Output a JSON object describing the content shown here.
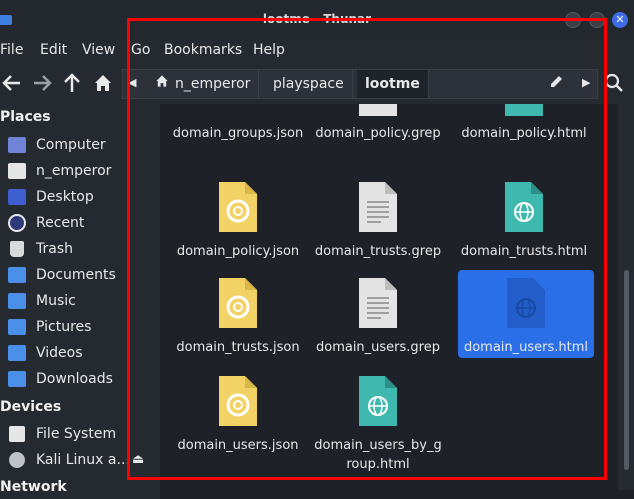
{
  "window": {
    "title": "lootme - Thunar"
  },
  "menu": [
    "File",
    "Edit",
    "View",
    "Go",
    "Bookmarks",
    "Help"
  ],
  "pathbar": {
    "crumbs": [
      "n_emperor",
      "playspace",
      "lootme"
    ]
  },
  "sidebar": {
    "places_header": "Places",
    "places": [
      {
        "label": "Computer",
        "icon": "computer-icon"
      },
      {
        "label": "n_emperor",
        "icon": "home-folder-icon"
      },
      {
        "label": "Desktop",
        "icon": "desktop-icon"
      },
      {
        "label": "Recent",
        "icon": "recent-icon"
      },
      {
        "label": "Trash",
        "icon": "trash-icon"
      },
      {
        "label": "Documents",
        "icon": "documents-folder-icon"
      },
      {
        "label": "Music",
        "icon": "music-folder-icon"
      },
      {
        "label": "Pictures",
        "icon": "pictures-folder-icon"
      },
      {
        "label": "Videos",
        "icon": "videos-folder-icon"
      },
      {
        "label": "Downloads",
        "icon": "downloads-folder-icon"
      }
    ],
    "devices_header": "Devices",
    "devices": [
      {
        "label": "File System",
        "icon": "drive-icon"
      },
      {
        "label": "Kali Linux a...",
        "icon": "disc-icon"
      }
    ],
    "network_header": "Network"
  },
  "files": [
    {
      "name": "domain_groups.json",
      "type": "json"
    },
    {
      "name": "domain_policy.grep",
      "type": "text"
    },
    {
      "name": "domain_policy.html",
      "type": "html"
    },
    {
      "name": "domain_policy.json",
      "type": "json"
    },
    {
      "name": "domain_trusts.grep",
      "type": "text"
    },
    {
      "name": "domain_trusts.html",
      "type": "html"
    },
    {
      "name": "domain_trusts.json",
      "type": "json"
    },
    {
      "name": "domain_users.grep",
      "type": "text"
    },
    {
      "name": "domain_users.html",
      "type": "html",
      "selected": true
    },
    {
      "name": "domain_users.json",
      "type": "json"
    },
    {
      "name": "domain_users_by_g\nroup.html",
      "type": "html"
    }
  ],
  "colors": {
    "accent": "#2b6fe8",
    "json": "#f2d264",
    "html": "#3fb8b0",
    "text": "#e4e4e4",
    "highlight": "#ff0000"
  }
}
